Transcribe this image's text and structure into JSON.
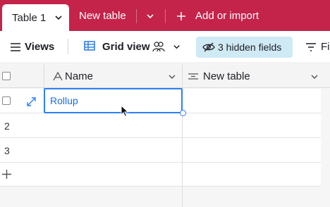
{
  "tabs": {
    "active_label": "Table 1",
    "other_label": "New table",
    "add_import_label": "Add or import"
  },
  "toolbar": {
    "views_label": "Views",
    "grid_view_label": "Grid view",
    "hidden_fields_label": "3 hidden fields",
    "filter_label": "Filter"
  },
  "grid": {
    "columns": [
      {
        "name": "Name",
        "type_icon": "text-type-icon"
      },
      {
        "name": "New table",
        "type_icon": "linked-record-icon"
      }
    ],
    "rows": [
      {
        "number": "1",
        "name": "Rollup",
        "new_table": ""
      },
      {
        "number": "2",
        "name": "",
        "new_table": ""
      },
      {
        "number": "3",
        "name": "",
        "new_table": ""
      }
    ]
  },
  "colors": {
    "brand": "#c4234a",
    "hidden_fields_bg": "#cfe9f5",
    "selection": "#2d7ff9",
    "cell_text": "#166ee1"
  }
}
